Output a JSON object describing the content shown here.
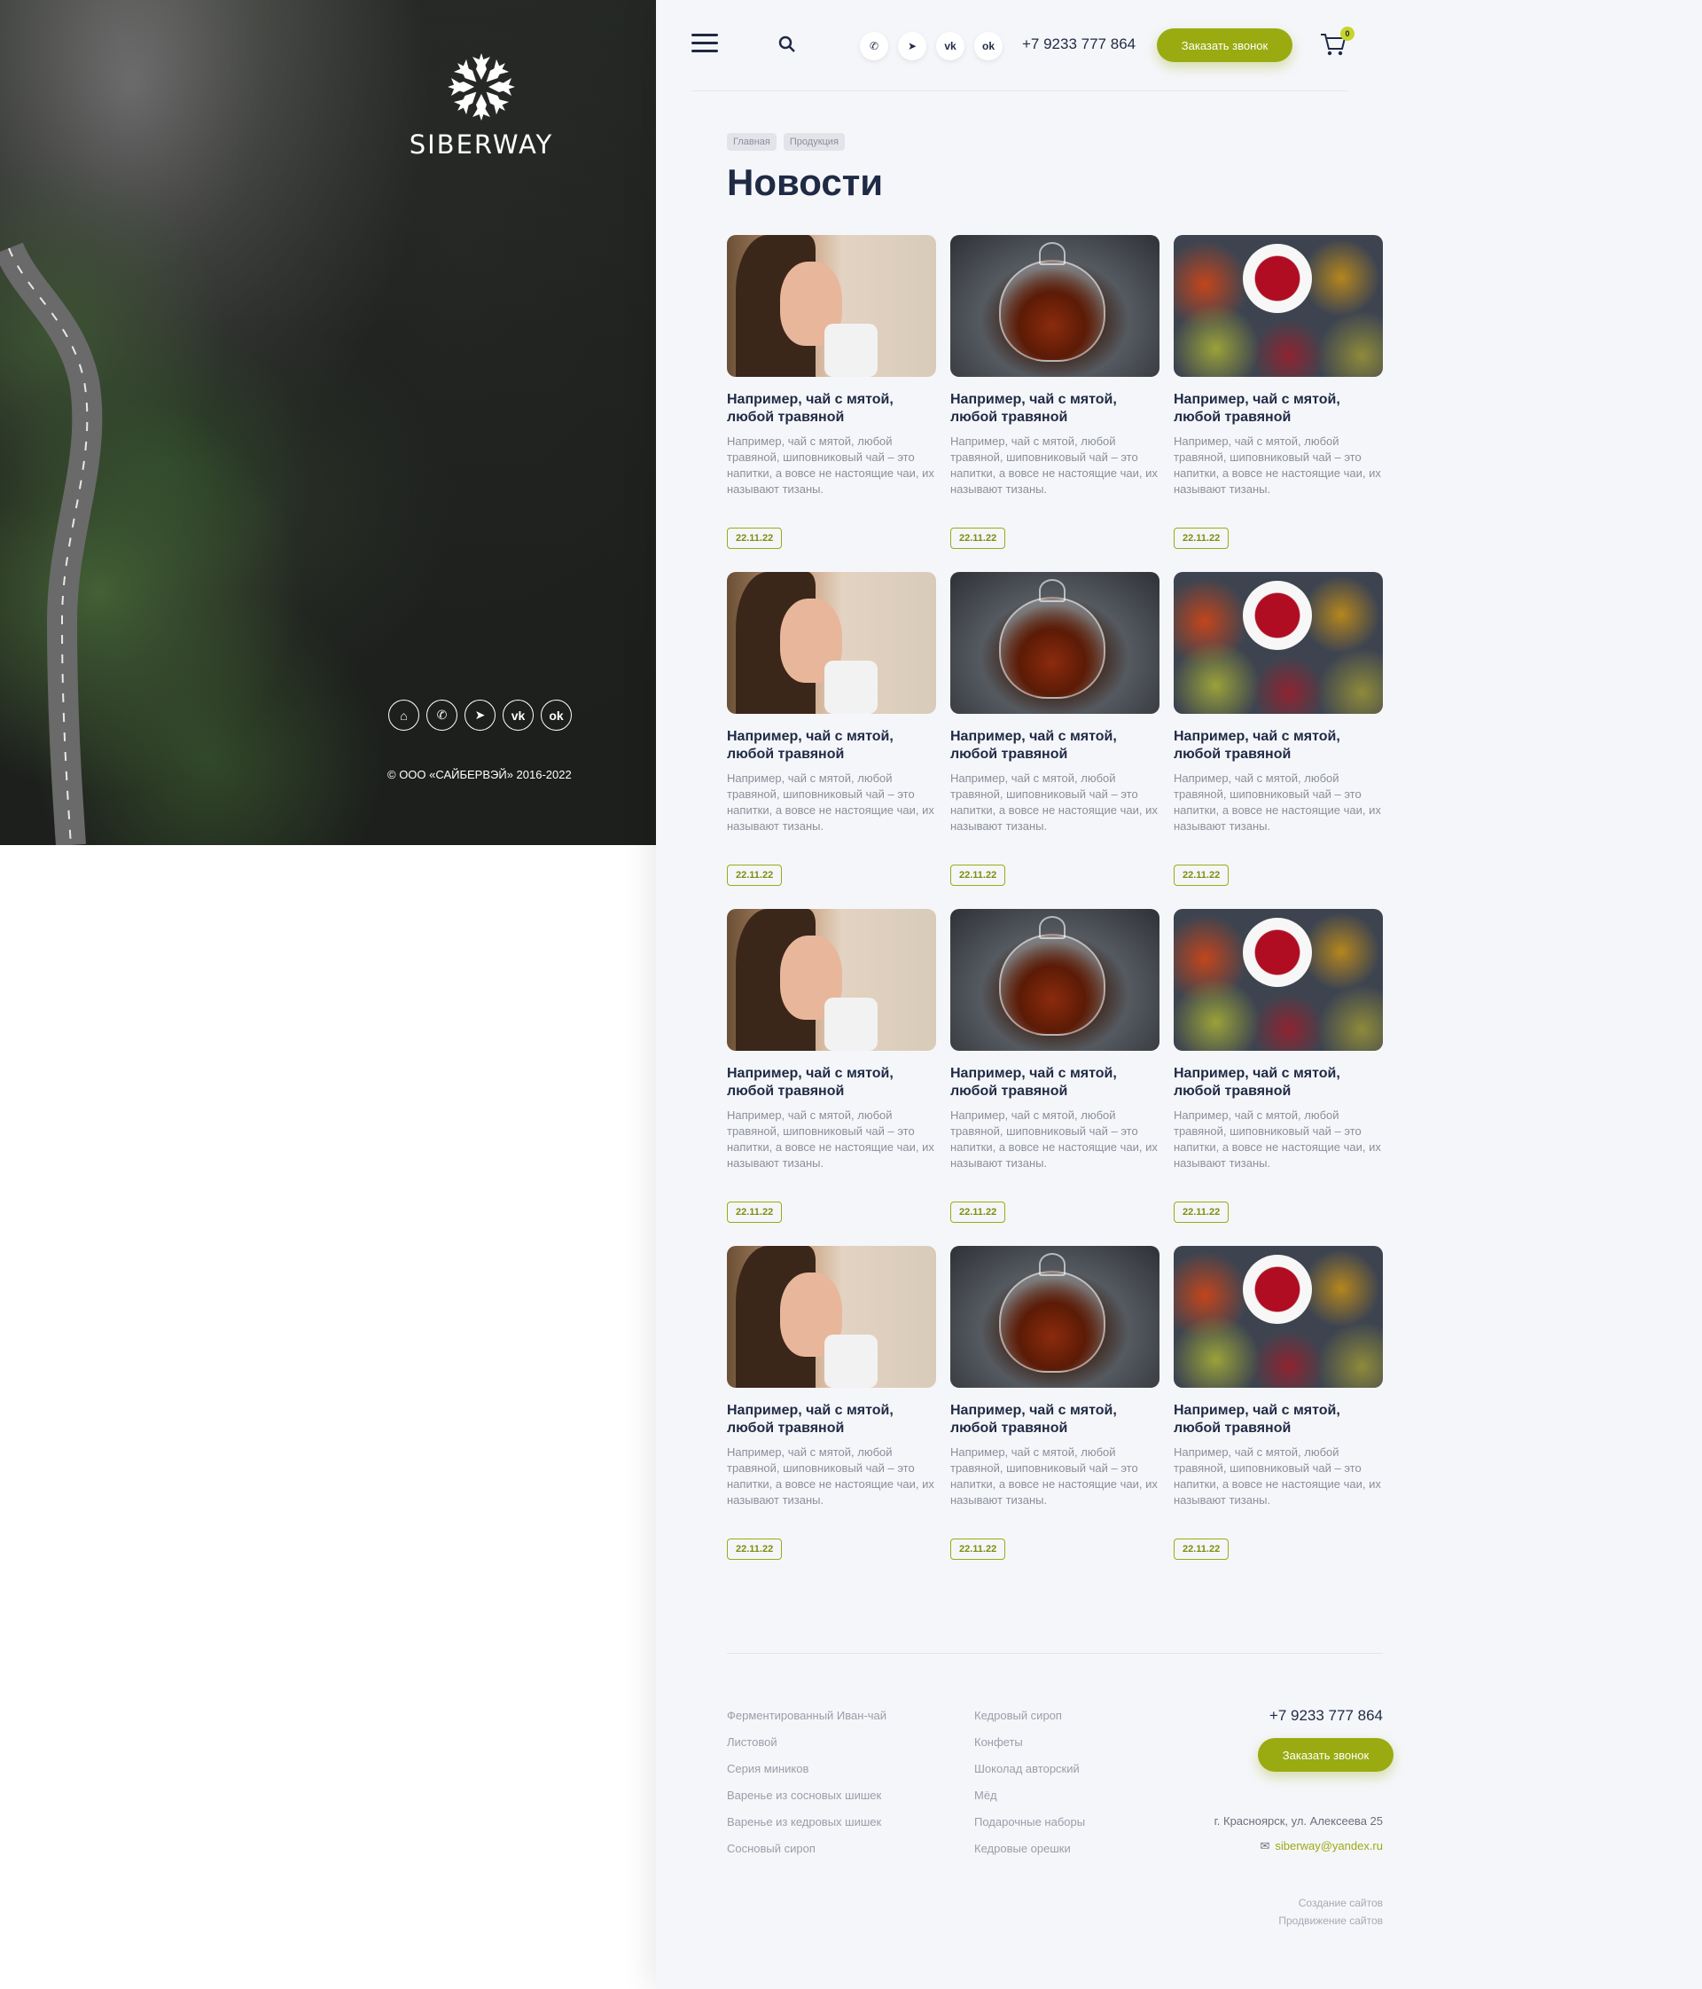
{
  "hero": {
    "brand": "SIBERWAY",
    "social_icons": [
      "home-icon",
      "whatsapp-icon",
      "telegram-icon",
      "vk-icon",
      "odnoklassniki-icon"
    ],
    "copyright": "© ООО «САЙБЕРВЭЙ» 2016-2022"
  },
  "header": {
    "social_icons": [
      "whatsapp-icon",
      "telegram-icon",
      "vk-icon",
      "odnoklassniki-icon"
    ],
    "phone": "+7 9233 777 864",
    "call_button": "Заказать звонок",
    "cart_count": "0"
  },
  "breadcrumbs": [
    "Главная",
    "Продукция"
  ],
  "page_title": "Новости",
  "colors": {
    "accent": "#9aab12",
    "dark": "#1f2a44",
    "muted": "#8b8f99",
    "bg": "#f5f6fa"
  },
  "news": [
    {
      "image": "woman-with-cup",
      "title": "Например, чай с мятой, любой травяной",
      "text": "Например, чай с мятой, любой травяной, шиповниковый чай – это напитки, а вовсе не настоящие чаи, их называют тизаны.",
      "date": "22.11.22"
    },
    {
      "image": "teapot",
      "title": "Например, чай с мятой, любой травяной",
      "text": "Например, чай с мятой, любой травяной, шиповниковый чай – это напитки, а вовсе не настоящие чаи, их называют тизаны.",
      "date": "22.11.22"
    },
    {
      "image": "tea-and-spices",
      "title": "Например, чай с мятой, любой травяной",
      "text": "Например, чай с мятой, любой травяной, шиповниковый чай – это напитки, а вовсе не настоящие чаи, их называют тизаны.",
      "date": "22.11.22"
    },
    {
      "image": "woman-with-cup",
      "title": "Например, чай с мятой, любой травяной",
      "text": "Например, чай с мятой, любой травяной, шиповниковый чай – это напитки, а вовсе не настоящие чаи, их называют тизаны.",
      "date": "22.11.22"
    },
    {
      "image": "teapot",
      "title": "Например, чай с мятой, любой травяной",
      "text": "Например, чай с мятой, любой травяной, шиповниковый чай – это напитки, а вовсе не настоящие чаи, их называют тизаны.",
      "date": "22.11.22"
    },
    {
      "image": "tea-and-spices",
      "title": "Например, чай с мятой, любой травяной",
      "text": "Например, чай с мятой, любой травяной, шиповниковый чай – это напитки, а вовсе не настоящие чаи, их называют тизаны.",
      "date": "22.11.22"
    },
    {
      "image": "woman-with-cup",
      "title": "Например, чай с мятой, любой травяной",
      "text": "Например, чай с мятой, любой травяной, шиповниковый чай – это напитки, а вовсе не настоящие чаи, их называют тизаны.",
      "date": "22.11.22"
    },
    {
      "image": "teapot",
      "title": "Например, чай с мятой, любой травяной",
      "text": "Например, чай с мятой, любой травяной, шиповниковый чай – это напитки, а вовсе не настоящие чаи, их называют тизаны.",
      "date": "22.11.22"
    },
    {
      "image": "tea-and-spices",
      "title": "Например, чай с мятой, любой травяной",
      "text": "Например, чай с мятой, любой травяной, шиповниковый чай – это напитки, а вовсе не настоящие чаи, их называют тизаны.",
      "date": "22.11.22"
    },
    {
      "image": "woman-with-cup",
      "title": "Например, чай с мятой, любой травяной",
      "text": "Например, чай с мятой, любой травяной, шиповниковый чай – это напитки, а вовсе не настоящие чаи, их называют тизаны.",
      "date": "22.11.22"
    },
    {
      "image": "teapot",
      "title": "Например, чай с мятой, любой травяной",
      "text": "Например, чай с мятой, любой травяной, шиповниковый чай – это напитки, а вовсе не настоящие чаи, их называют тизаны.",
      "date": "22.11.22"
    },
    {
      "image": "tea-and-spices",
      "title": "Например, чай с мятой, любой травяной",
      "text": "Например, чай с мятой, любой травяной, шиповниковый чай – это напитки, а вовсе не настоящие чаи, их называют тизаны.",
      "date": "22.11.22"
    }
  ],
  "footer": {
    "col1": [
      "Ферментированный Иван-чай",
      "Листовой",
      "Серия миников",
      "Варенье из сосновых шишек",
      "Варенье из кедровых шишек",
      "Сосновый сироп"
    ],
    "col2": [
      "Кедровый сироп",
      "Конфеты",
      "Шоколад авторский",
      "Мёд",
      "Подарочные наборы",
      "Кедровые орешки"
    ],
    "phone": "+7 9233 777 864",
    "call_button": "Заказать звонок",
    "address": "г. Красноярск, ул. Алексеева 25",
    "email": "siberway@yandex.ru",
    "dev1": "Создание сайтов",
    "dev2": "Продвижение сайтов"
  }
}
